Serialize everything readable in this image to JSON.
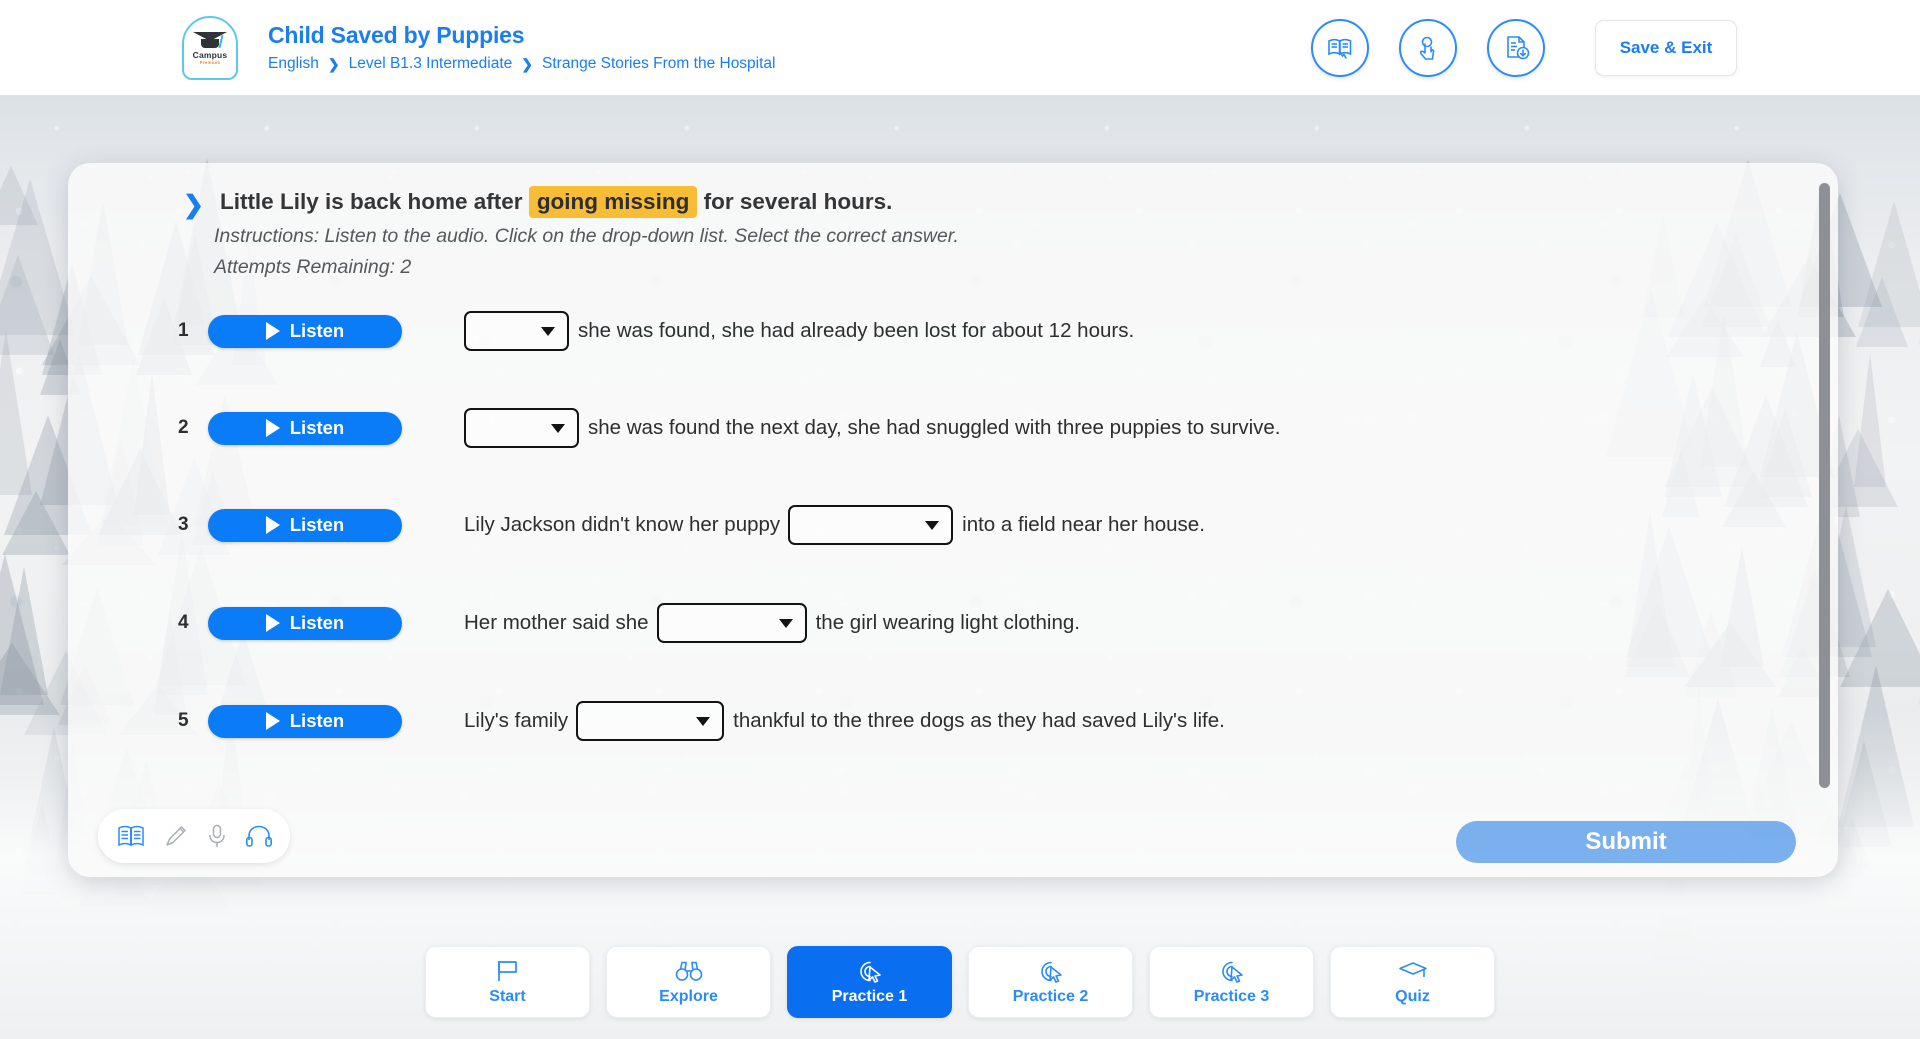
{
  "header": {
    "logo": {
      "word": "Campus",
      "sub": "Premium",
      "icon": "graduation-cap-icon"
    },
    "course_title": "Child Saved by Puppies",
    "breadcrumb": [
      {
        "label": "English"
      },
      {
        "label": "Level B1.3 Intermediate"
      },
      {
        "label": "Strange Stories From the Hospital"
      }
    ],
    "breadcrumb_separator": "❯",
    "actions": [
      {
        "name": "read-along-icon",
        "title": "Read"
      },
      {
        "name": "tap-gesture-icon",
        "title": "Interact"
      },
      {
        "name": "document-download-icon",
        "title": "Download"
      }
    ],
    "save_exit_label": "Save & Exit",
    "accent_color": "#1a7ef0"
  },
  "exercise": {
    "chevron": "❯",
    "prompt_before": "Little Lily is back home after",
    "prompt_highlight": "going missing",
    "prompt_after": "for several hours.",
    "highlight_color": "#f9bc35",
    "instructions": "Instructions: Listen to the audio. Click on the drop-down list. Select the correct answer.",
    "attempts": "Attempts Remaining: 2",
    "listen_label": "Listen",
    "questions": [
      {
        "number": "1",
        "listen_label": "Listen",
        "text_before": "",
        "dropdown_value": "",
        "text_after": "she was found, she had already been lost for about 12 hours."
      },
      {
        "number": "2",
        "listen_label": "Listen",
        "text_before": "",
        "dropdown_value": "",
        "text_after": "she was found the next day, she had snuggled with three puppies to survive."
      },
      {
        "number": "3",
        "listen_label": "Listen",
        "text_before": "Lily Jackson didn't know her puppy",
        "dropdown_value": "",
        "text_after": "into a field near her house."
      },
      {
        "number": "4",
        "listen_label": "Listen",
        "text_before": "Her mother said she",
        "dropdown_value": "",
        "text_after": "the girl wearing light clothing."
      },
      {
        "number": "5",
        "listen_label": "Listen",
        "text_before": "Lily's family",
        "dropdown_value": "",
        "text_after": "thankful to the three dogs as they had saved Lily's life."
      }
    ],
    "tools": [
      {
        "name": "book-icon",
        "active": true
      },
      {
        "name": "pencil-icon",
        "active": false
      },
      {
        "name": "microphone-icon",
        "active": false
      },
      {
        "name": "headphones-icon",
        "active": true
      }
    ],
    "submit_label": "Submit"
  },
  "bottom_nav": {
    "tabs": [
      {
        "label": "Start",
        "icon": "flag-icon",
        "active": false
      },
      {
        "label": "Explore",
        "icon": "binoculars-icon",
        "active": false
      },
      {
        "label": "Practice 1",
        "icon": "cursor-target-icon",
        "active": true
      },
      {
        "label": "Practice 2",
        "icon": "cursor-target-icon",
        "active": false
      },
      {
        "label": "Practice 3",
        "icon": "cursor-target-icon",
        "active": false
      },
      {
        "label": "Quiz",
        "icon": "graduation-cap-icon",
        "active": false
      }
    ],
    "active_color": "#0a6ef0"
  }
}
